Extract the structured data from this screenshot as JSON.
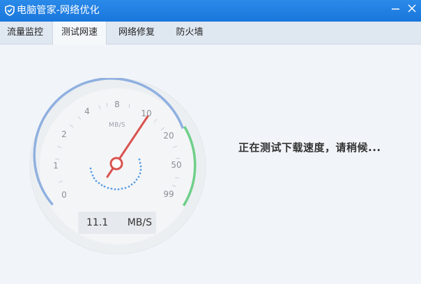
{
  "window": {
    "title": "电脑管家-网络优化"
  },
  "tabs": [
    {
      "label": "流量监控"
    },
    {
      "label": "测试网速"
    },
    {
      "label": "网络修复"
    },
    {
      "label": "防火墙"
    }
  ],
  "active_tab": "测试网速",
  "gauge": {
    "scale_labels": [
      "0",
      "1",
      "2",
      "4",
      "8",
      "10",
      "20",
      "50",
      "99"
    ],
    "unit": "MB/S",
    "needle_value": 10,
    "readout_value": "11.1",
    "readout_unit": "MB/S"
  },
  "status": {
    "message": "正在测试下载速度，请稍候..."
  },
  "colors": {
    "titlebar": "#1f7fe3",
    "arc_blue": "#8fb0e0",
    "arc_green": "#6fcf88",
    "needle": "#d9534f",
    "dots": "#5a9ee6"
  }
}
